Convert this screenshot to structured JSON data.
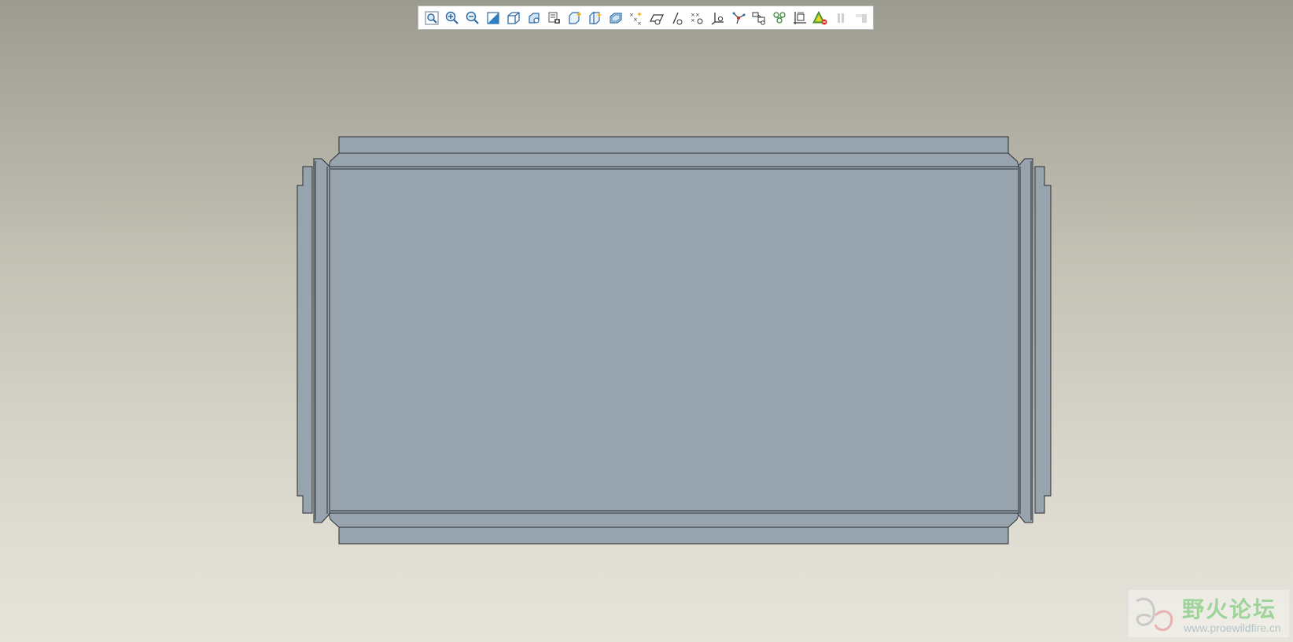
{
  "toolbar": {
    "buttons": [
      {
        "icon": "zoom-refit-icon",
        "state": "enabled"
      },
      {
        "icon": "zoom-in-icon",
        "state": "enabled"
      },
      {
        "icon": "zoom-out-icon",
        "state": "enabled"
      },
      {
        "icon": "repaint-icon",
        "state": "enabled"
      },
      {
        "icon": "display-style-icon",
        "state": "enabled"
      },
      {
        "icon": "saved-orientations-icon",
        "state": "enabled"
      },
      {
        "icon": "view-manager-icon",
        "state": "enabled"
      },
      {
        "icon": "datum-planes-icon",
        "state": "enabled"
      },
      {
        "icon": "datum-axes-icon",
        "state": "enabled"
      },
      {
        "icon": "point-display-icon",
        "state": "enabled"
      },
      {
        "icon": "coordinate-systems-icon",
        "state": "enabled"
      },
      {
        "icon": "plane-tag-icon",
        "state": "enabled"
      },
      {
        "icon": "axis-tag-icon",
        "state": "enabled"
      },
      {
        "icon": "point-tag-icon",
        "state": "enabled"
      },
      {
        "icon": "csys-tag-icon",
        "state": "enabled"
      },
      {
        "icon": "spin-center-icon",
        "state": "enabled"
      },
      {
        "icon": "annotation-display-icon",
        "state": "enabled"
      },
      {
        "icon": "model-tree-filter-icon",
        "state": "enabled"
      },
      {
        "icon": "dimension-icon",
        "state": "enabled"
      },
      {
        "icon": "analysis-icon",
        "state": "enabled"
      },
      {
        "icon": "pause-icon",
        "state": "disabled"
      },
      {
        "icon": "end-icon",
        "state": "disabled"
      }
    ]
  },
  "colors": {
    "part_fill": "#97a4ae",
    "part_edge": "#2a2e33",
    "accent": "#2d7fc1"
  },
  "watermark": {
    "title": "野火论坛",
    "url": "www.proewildfire.cn"
  }
}
